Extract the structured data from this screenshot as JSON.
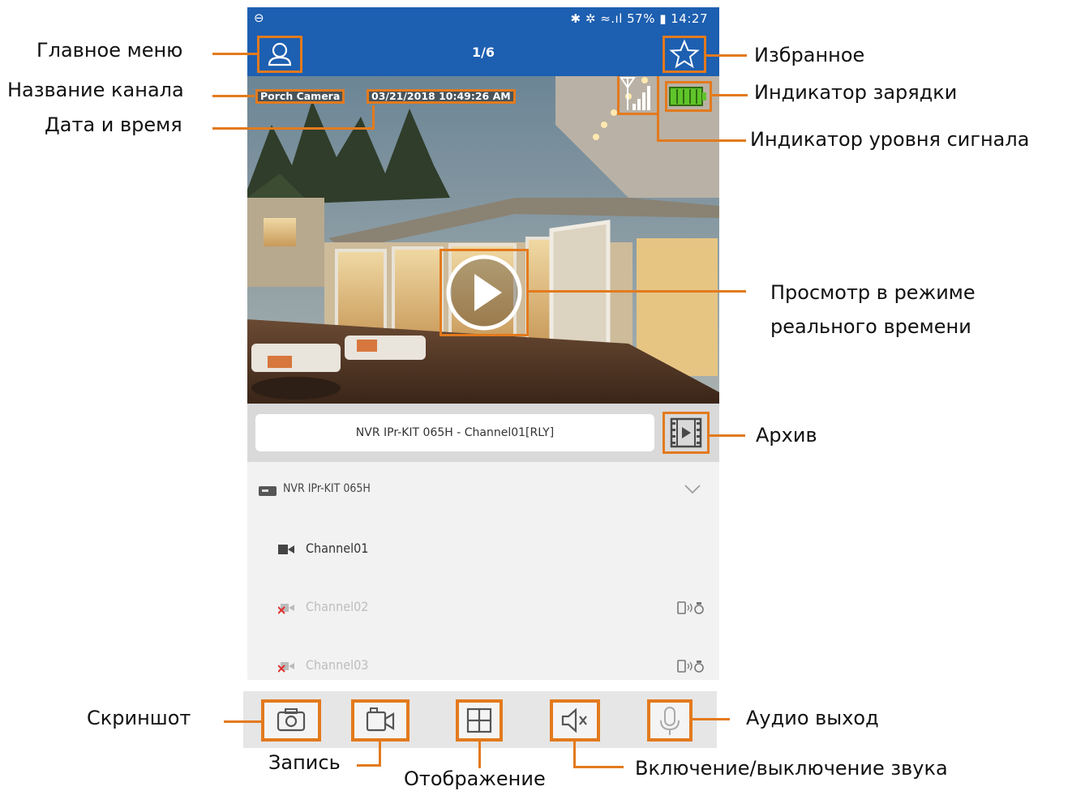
{
  "status_bar": {
    "left_icon": "minus-circle-icon",
    "right_text": "✱ ✲ ≈.ıl 57% ▮ 14:27"
  },
  "title_bar": {
    "page_indicator": "1/6",
    "left_icon": "user-icon",
    "right_icon": "star-icon"
  },
  "video": {
    "channel_name": "Porch Camera",
    "datetime": "03/21/2018  10:49:26 AM",
    "signal_icon": "signal-icon",
    "battery_icon": "battery-icon",
    "battery_color": "#5fc42a",
    "play_icon": "play-icon"
  },
  "device_bar": {
    "name": "NVR IPr-KIT 065H - Channel01[RLY]",
    "archive_icon": "film-icon"
  },
  "device_list": {
    "device": "NVR IPr-KIT 065H",
    "channels": [
      {
        "label": "Channel01",
        "active": true
      },
      {
        "label": "Channel02",
        "active": false
      },
      {
        "label": "Channel03",
        "active": false
      }
    ]
  },
  "toolbar": {
    "screenshot_icon": "camera-icon",
    "record_icon": "video-camera-icon",
    "layout_icon": "grid-icon",
    "mute_icon": "speaker-muted-icon",
    "mic_icon": "microphone-icon"
  },
  "callouts": {
    "main_menu": "Главное меню",
    "channel_name": "Название канала",
    "date_time": "Дата и время",
    "favorites": "Избранное",
    "charge_indicator": "Индикатор зарядки",
    "signal_indicator": "Индикатор уровня сигнала",
    "live_view_line1": "Просмотр в режиме",
    "live_view_line2": "реального времени",
    "archive": "Архив",
    "screenshot": "Скриншот",
    "record": "Запись",
    "display": "Отображение",
    "sound_toggle": "Включение/выключение звука",
    "audio_out": "Аудио выход"
  },
  "colors": {
    "accent": "#e37a1d",
    "app_bar": "#1d5fb0"
  }
}
